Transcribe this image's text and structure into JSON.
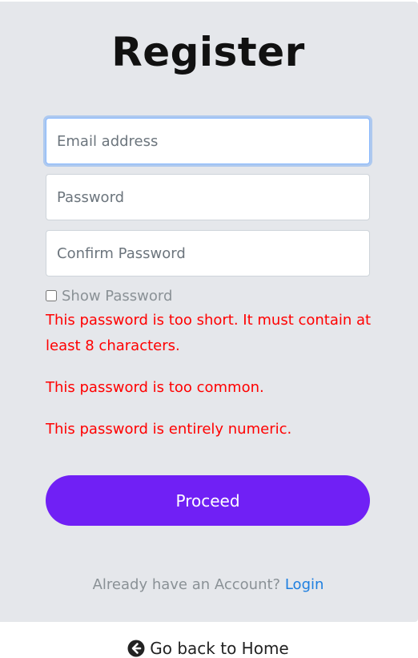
{
  "page": {
    "title": "Register"
  },
  "form": {
    "email_placeholder": "Email address",
    "password_placeholder": "Password",
    "confirm_placeholder": "Confirm Password",
    "show_password_label": "Show Password",
    "errors": [
      "This password is too short. It must contain at least 8 characters.",
      "This password is too common.",
      "This password is entirely numeric."
    ],
    "submit_label": "Proceed"
  },
  "footer": {
    "already_text": "Already have an Account?",
    "login_label": "Login",
    "home_label": "Go back to Home",
    "home_icon": "arrow-circle-left-icon"
  },
  "colors": {
    "card_bg": "#e5e7eb",
    "button": "#7020f5",
    "error": "#ff0000",
    "link": "#1e7fe0"
  }
}
